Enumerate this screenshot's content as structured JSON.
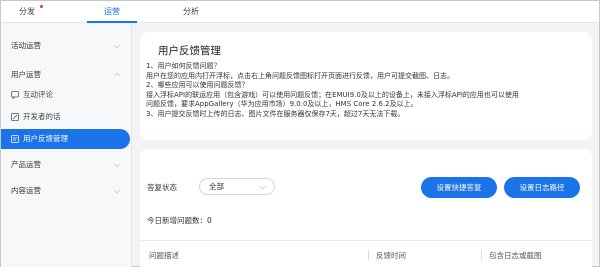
{
  "topnav": {
    "tabs": [
      {
        "label": "分发",
        "has_dot": true
      },
      {
        "label": "运营",
        "active": true
      },
      {
        "label": "分析"
      }
    ],
    "colors": {
      "accent": "#1a73e8",
      "dot": "#e53935"
    }
  },
  "sidebar": {
    "groups": [
      {
        "label": "活动运营",
        "expanded": false
      },
      {
        "label": "用户运营",
        "expanded": true,
        "items": [
          {
            "label": "互动评论",
            "icon": "comment-icon"
          },
          {
            "label": "开发者的话",
            "icon": "edit-icon"
          },
          {
            "label": "用户反馈管理",
            "icon": "feedback-icon",
            "active": true
          }
        ]
      },
      {
        "label": "产品运营",
        "expanded": false
      },
      {
        "label": "内容运营",
        "expanded": false
      }
    ]
  },
  "main": {
    "title": "用户反馈管理",
    "faq": [
      "1、用户如何反馈问题？",
      "用户在您的应用内打开浮标，点击右上角问题反馈图标打开页面进行反馈，用户可提交截图、日志。",
      "2、哪些应用可以使用问题反馈？",
      "接入浮标API的联运应用（包含游戏）可以使用问题反馈；在EMUI9.0及以上的设备上，未接入浮标API的应用也可以使用",
      "问题反馈，要求AppGallery（华为应用市场）9.0.0及以上，HMS Core 2.6.2及以上。",
      "3、用户提交反馈时上传的日志、图片文件在服务器仅保存7天，超过7天无法下载。"
    ],
    "filter": {
      "status_label": "答复状态",
      "status_value": "全部",
      "btn_quick_reply": "设置快捷答复",
      "btn_log_path": "设置日志路径",
      "new_count_text": "今日新增问题数：0"
    },
    "table": {
      "columns": [
        "问题描述",
        "反馈时间",
        "包含日志或截图"
      ]
    }
  }
}
